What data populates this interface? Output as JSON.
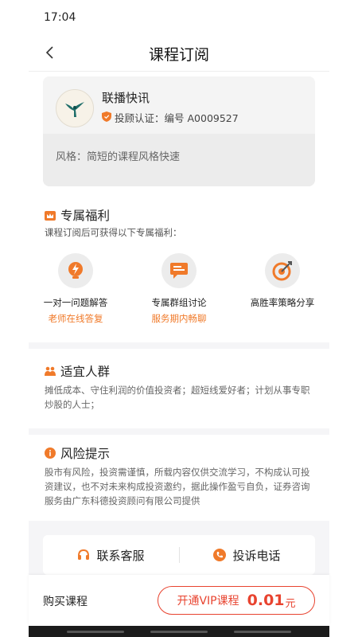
{
  "status_bar": {
    "time": "17:04"
  },
  "nav": {
    "title": "课程订阅",
    "back_icon": "chevron-left-icon"
  },
  "advisor": {
    "name": "联播快讯",
    "cert_label": "投顾认证：",
    "cert_number": "编号 A0009527",
    "style": "风格：简短的课程风格快速"
  },
  "benefits": {
    "title": "专属福利",
    "subtitle": "课程订阅后可获得以下专属福利：",
    "items": [
      {
        "title": "一对一问题解答",
        "sub": "老师在线答复",
        "icon": "lightbulb-icon"
      },
      {
        "title": "专属群组讨论",
        "sub": "服务期内畅聊",
        "icon": "chat-icon"
      },
      {
        "title": "高胜率策略分享",
        "sub": "",
        "icon": "target-icon"
      }
    ]
  },
  "audience": {
    "title": "适宜人群",
    "body": "摊低成本、守住利润的价值投资者；超短线爱好者；计划从事专职炒股的人士；"
  },
  "risk": {
    "title": "风险提示",
    "body": "股市有风险，投资需谨慎，所载内容仅供交流学习，不构成认可投资建议，也不对未来构成投资邀约，据此操作盈亏自负，证券咨询服务由广东科德投资顾问有限公司提供"
  },
  "contact": {
    "service_label": "联系客服",
    "complaint_label": "投诉电话"
  },
  "purchase": {
    "label": "购买课程",
    "vip_text": "开通VIP课程",
    "price": "0.01",
    "unit": "元"
  },
  "colors": {
    "accent_orange": "#f07a2a",
    "price_red": "#e8432f"
  }
}
